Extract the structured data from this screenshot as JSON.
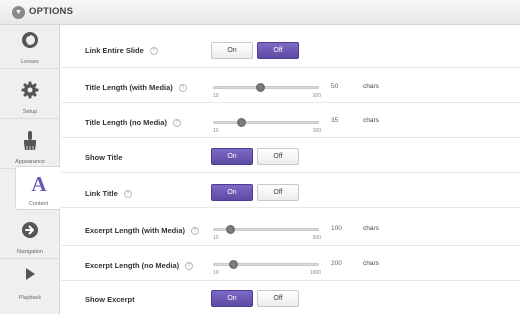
{
  "header": {
    "title": "OPTIONS",
    "collapse_glyph": "▼"
  },
  "sidebar": {
    "items": [
      {
        "label": "Lenses",
        "icon": "lens-icon"
      },
      {
        "label": "Setup",
        "icon": "gear-icon"
      },
      {
        "label": "Appearance",
        "icon": "brush-icon"
      },
      {
        "label": "Content",
        "icon": "font-a-icon",
        "active": true
      },
      {
        "label": "Navigation",
        "icon": "arrow-circle-icon"
      },
      {
        "label": "Playback",
        "icon": "play-icon"
      }
    ]
  },
  "toggle_labels": {
    "on": "On",
    "off": "Off"
  },
  "help_glyph": "?",
  "rows": {
    "link_entire_slide": {
      "label": "Link Entire Slide",
      "value": "Off"
    },
    "title_length_media": {
      "label": "Title Length (with Media)",
      "min": "10",
      "max": "100",
      "value": "50",
      "unit": "chars"
    },
    "title_length_no_media": {
      "label": "Title Length (no Media)",
      "min": "10",
      "max": "100",
      "value": "35",
      "unit": "chars"
    },
    "show_title": {
      "label": "Show Title",
      "value": "On"
    },
    "link_title": {
      "label": "Link Title",
      "value": "On"
    },
    "excerpt_length_media": {
      "label": "Excerpt Length (with Media)",
      "min": "10",
      "max": "500",
      "value": "100",
      "unit": "chars"
    },
    "excerpt_length_no_media": {
      "label": "Excerpt Length (no Media)",
      "min": "10",
      "max": "1000",
      "value": "200",
      "unit": "chars"
    },
    "show_excerpt": {
      "label": "Show Excerpt",
      "value": "On"
    }
  },
  "colors": {
    "accent": "#6a57b5",
    "icon": "#555555"
  }
}
